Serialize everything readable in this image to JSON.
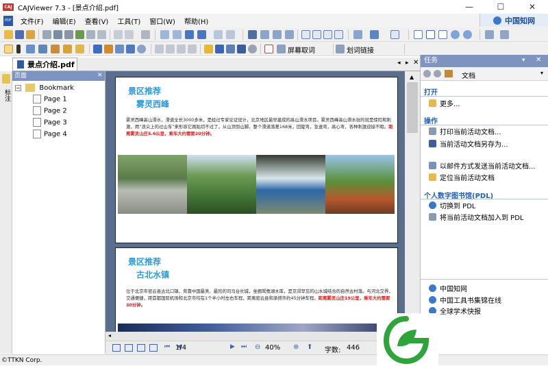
{
  "window": {
    "title": "CAJViewer 7.3 - [景点介绍.pdf]",
    "app_icon": "CAJ",
    "controls": [
      "—",
      "☐",
      "✕"
    ]
  },
  "menu": {
    "items": [
      "文件(F)",
      "编辑(E)",
      "查看(V)",
      "工具(T)",
      "窗口(W)",
      "帮助(H)"
    ],
    "doc_icon": "PDF"
  },
  "brand": {
    "text": "中国知网"
  },
  "toolbar2": {
    "screen_ocr": "屏幕取词",
    "word_link": "划词链接"
  },
  "tab": {
    "label": "景点介绍.pdf"
  },
  "left_panel": {
    "header": "页面",
    "vertical_tab": "标注",
    "tree": {
      "root": "Bookmark",
      "pages": [
        "Page 1",
        "Page 2",
        "Page 3",
        "Page 4"
      ]
    }
  },
  "document": {
    "page1": {
      "section": "景区推荐",
      "name": "雾灵西峰",
      "body": "雾灵西峰高山滑水，滑道全长3000多米，是经过专家论证设计，北京地区最早建成的高山滑水项目。雾灵西峰高山滑水玩的就是惊险和刺激，用“浪尖上的过山车”来形容它再贴切不过了，从山顶到山脚，整个滑道落差168米，回旋弯，急速弯，高心弯，各种刺激迎接不暇。",
      "highlight": "距离雾灵山庄5.6公里，乘车大约需要20分钟。"
    },
    "page2": {
      "section": "景区推荐",
      "name": "古北水镇",
      "body": "位于北京市密云县古北口镇，背靠中国最美、最险的司马台长城，坐拥鸳鸯湖水库，是京郊罕见的山水城结合的自然古村落。与河北交界，交通便捷，距首都国际机场和北京市均在1个半小时左右车程，距离密云县和承德市约45分钟车程。",
      "highlight": "距离雾灵山庄19公里，乘车大约需要30分钟。"
    }
  },
  "navbar": {
    "page": "1/4",
    "zoom": "40%",
    "word_count_label": "字数:",
    "word_count": "446"
  },
  "task_panel": {
    "header": "任务",
    "address": "文档",
    "open_title": "打开",
    "open_items": [
      "更多..."
    ],
    "ops_title": "操作",
    "ops_items": [
      "打印当前活动文档...",
      "当前活动文档另存为...",
      "以邮件方式发送当前活动文档...",
      "定位当前活动文档"
    ],
    "pdl_title": "个人数字图书馆(PDL)",
    "pdl_items": [
      "切换到 PDL",
      "将当前活动文档加入到 PDL"
    ],
    "links": [
      "中国知网",
      "中国工具书集锦在线",
      "全球学术快报"
    ]
  },
  "status": {
    "text": "©TTKN Corp."
  }
}
